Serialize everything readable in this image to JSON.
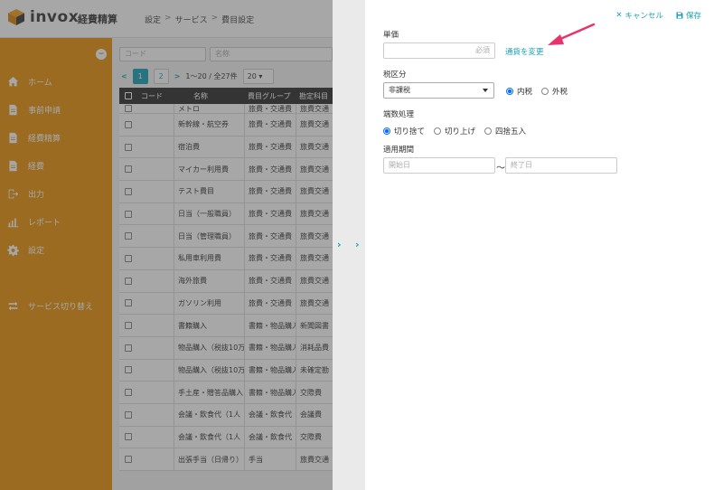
{
  "app": {
    "logo_text": "invox",
    "logo_sub": "経費精算",
    "breadcrumb": [
      "設定",
      "サービス",
      "費目設定"
    ]
  },
  "sidebar": {
    "items": [
      {
        "label": "ホーム",
        "icon": "home-icon"
      },
      {
        "label": "事前申請",
        "icon": "document-icon"
      },
      {
        "label": "経費精算",
        "icon": "document-icon"
      },
      {
        "label": "経費",
        "icon": "document-icon"
      },
      {
        "label": "出力",
        "icon": "export-icon"
      },
      {
        "label": "レポート",
        "icon": "bar-chart-icon"
      },
      {
        "label": "設定",
        "icon": "gear-icon"
      },
      {
        "label": "サービス切り替え",
        "icon": "switch-icon"
      }
    ]
  },
  "list": {
    "filter_code_placeholder": "コード",
    "filter_name_placeholder": "名称",
    "pages": [
      "1",
      "2"
    ],
    "range_text": "1〜20 / 全27件",
    "page_size": "20",
    "columns": [
      "コード",
      "名称",
      "費目グループ",
      "勘定科目"
    ],
    "rows": [
      {
        "code": "",
        "name": "メトロ",
        "group": "旅費・交通費",
        "account": "旅費交通"
      },
      {
        "code": "",
        "name": "新幹線・航空券",
        "group": "旅費・交通費",
        "account": "旅費交通"
      },
      {
        "code": "",
        "name": "宿泊費",
        "group": "旅費・交通費",
        "account": "旅費交通"
      },
      {
        "code": "",
        "name": "マイカー利用費",
        "group": "旅費・交通費",
        "account": "旅費交通"
      },
      {
        "code": "",
        "name": "テスト費目",
        "group": "旅費・交通費",
        "account": "旅費交通"
      },
      {
        "code": "",
        "name": "日当（一般職員）",
        "group": "旅費・交通費",
        "account": "旅費交通"
      },
      {
        "code": "",
        "name": "日当（管理職員）",
        "group": "旅費・交通費",
        "account": "旅費交通"
      },
      {
        "code": "",
        "name": "私用車利用費",
        "group": "旅費・交通費",
        "account": "旅費交通"
      },
      {
        "code": "",
        "name": "海外旅費",
        "group": "旅費・交通費",
        "account": "旅費交通"
      },
      {
        "code": "",
        "name": "ガソリン利用",
        "group": "旅費・交通費",
        "account": "旅費交通"
      },
      {
        "code": "",
        "name": "書籍購入",
        "group": "書籍・物品購入",
        "account": "新聞図書"
      },
      {
        "code": "",
        "name": "物品購入（税抜10万",
        "group": "書籍・物品購入",
        "account": "消耗品費"
      },
      {
        "code": "",
        "name": "物品購入（税抜10万",
        "group": "書籍・物品購入",
        "account": "未確定勘"
      },
      {
        "code": "",
        "name": "手土産・贈答品購入",
        "group": "書籍・物品購入",
        "account": "交際費"
      },
      {
        "code": "",
        "name": "会議・飲食代（1人",
        "group": "会議・飲食代",
        "account": "会議費"
      },
      {
        "code": "",
        "name": "会議・飲食代（1人",
        "group": "会議・飲食代",
        "account": "交際費"
      },
      {
        "code": "",
        "name": "出張手当（日帰り）",
        "group": "手当",
        "account": "旅費交通"
      }
    ]
  },
  "panel": {
    "cancel_label": "キャンセル",
    "save_label": "保存",
    "unit_price_label": "単価",
    "unit_price_placeholder": "必須",
    "currency_link": "通貨を変更",
    "tax_label": "税区分",
    "tax_select_value": "非課税",
    "tax_options": [
      {
        "label": "内税",
        "checked": true
      },
      {
        "label": "外税",
        "checked": false
      }
    ],
    "rounding_label": "端数処理",
    "rounding_options": [
      {
        "label": "切り捨て",
        "checked": true
      },
      {
        "label": "切り上げ",
        "checked": false
      },
      {
        "label": "四捨五入",
        "checked": false
      }
    ],
    "period_label": "適用期間",
    "start_placeholder": "開始日",
    "end_placeholder": "終了日",
    "range_separator": "〜"
  },
  "colors": {
    "sidebar": "#e7920c",
    "accent": "#17a2b8",
    "annotation_arrow": "#e8336d",
    "radio_checked": "#0d6efd"
  }
}
